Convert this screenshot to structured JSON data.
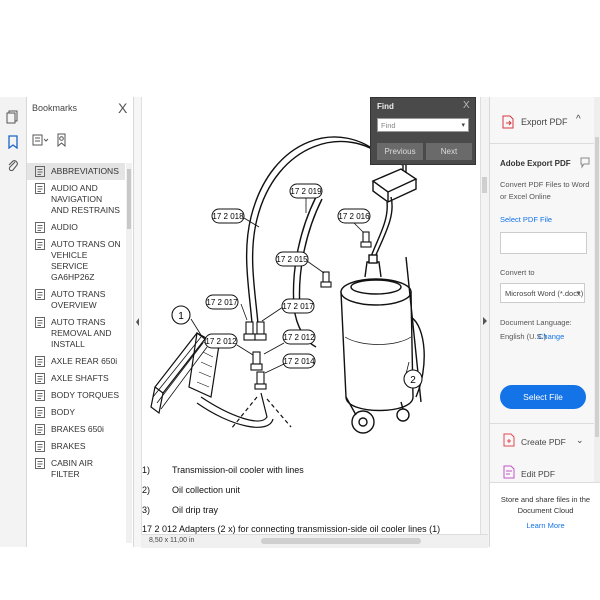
{
  "toolrail": {
    "icons": [
      "page-thumbnails-icon",
      "bookmark-icon",
      "attachment-icon"
    ]
  },
  "bookmarks": {
    "title": "Bookmarks",
    "close_glyph": "X",
    "items": [
      {
        "label": "ABBREVIATIONS",
        "selected": true
      },
      {
        "label": "AUDIO AND NAVIGATION AND RESTRAINS"
      },
      {
        "label": "AUDIO"
      },
      {
        "label": "AUTO TRANS ON VEHICLE SERVICE GA6HP26Z"
      },
      {
        "label": "AUTO TRANS OVERVIEW"
      },
      {
        "label": "AUTO TRANS REMOVAL AND INSTALL"
      },
      {
        "label": "AXLE REAR 650i"
      },
      {
        "label": "AXLE SHAFTS"
      },
      {
        "label": "BODY TORQUES"
      },
      {
        "label": "BODY"
      },
      {
        "label": "BRAKES 650i"
      },
      {
        "label": "BRAKES"
      },
      {
        "label": "CABIN AIR FILTER"
      }
    ]
  },
  "find": {
    "title": "Find",
    "close_glyph": "X",
    "placeholder": "Find",
    "previous": "Previous",
    "next": "Next"
  },
  "diagram": {
    "callouts": [
      "17 2 019",
      "17 2 018",
      "17 2 016",
      "17 2 015",
      "17 2 017",
      "17 2 017",
      "17 2 012",
      "17 2 012",
      "17 2 014"
    ],
    "numbers": [
      "1",
      "2"
    ]
  },
  "captions": [
    {
      "num": "1)",
      "text": "Transmission-oil cooler with lines"
    },
    {
      "num": "2)",
      "text": "Oil collection unit"
    },
    {
      "num": "3)",
      "text": "Oil drip tray"
    }
  ],
  "caption_last": "17 2 012 Adapters (2 x) for connecting transmission-side oil cooler lines (1)",
  "page_size": "8,50 x 11,00 in",
  "right_panel": {
    "export_title": "Export PDF",
    "adobe_export": "Adobe Export PDF",
    "convert_desc_1": "Convert PDF Files to Word",
    "convert_desc_2": "or Excel Online",
    "select_pdf": "Select PDF File",
    "convert_to": "Convert to",
    "format": "Microsoft Word (*.docx)",
    "doc_lang": "Document Language:",
    "lang_value": "English (U.S.)",
    "change": "Change",
    "select_file_btn": "Select File",
    "create_pdf": "Create PDF",
    "edit_pdf": "Edit PDF",
    "cloud_1": "Store and share files in the",
    "cloud_2": "Document Cloud",
    "learn_more": "Learn More"
  },
  "colors": {
    "accent": "#1473e6",
    "create_icon": "#e34850",
    "export_icon": "#d7373f"
  }
}
